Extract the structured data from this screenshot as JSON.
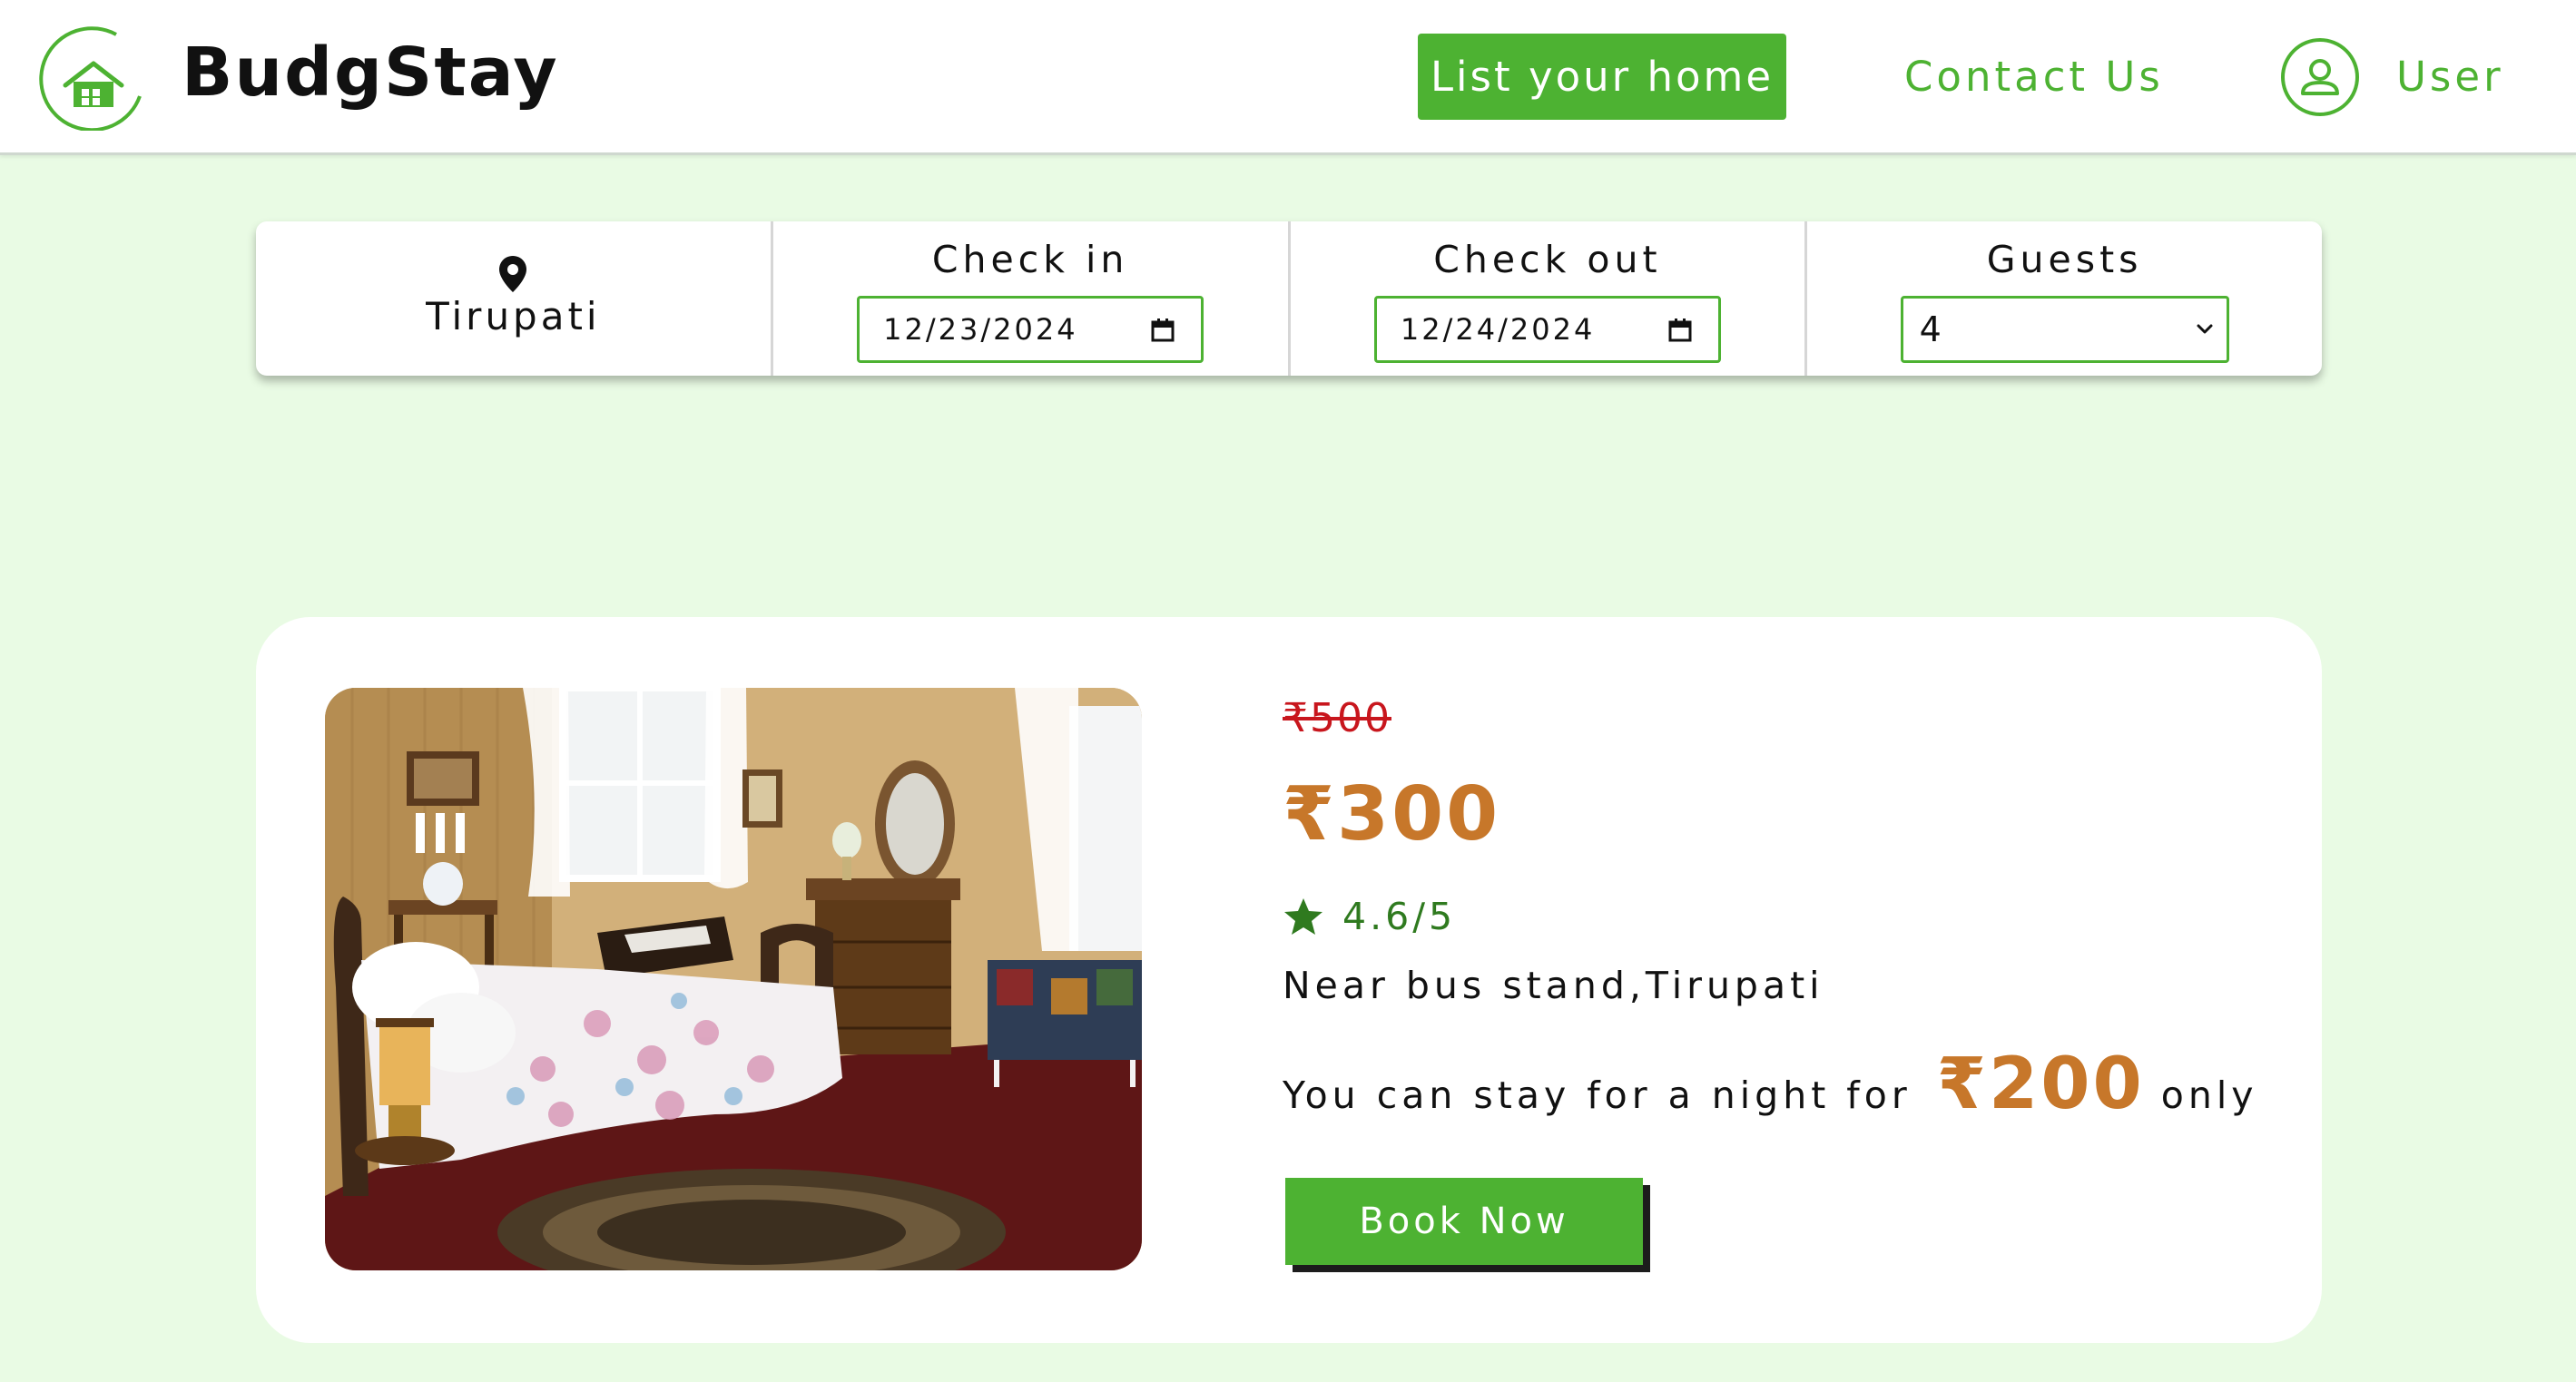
{
  "header": {
    "brand": "BudgStay",
    "list_home_label": "List your home",
    "contact_label": "Contact Us",
    "user_label": "User"
  },
  "search": {
    "location": "Tirupati",
    "check_in_label": "Check in",
    "check_in_value": "12/23/2024",
    "check_out_label": "Check out",
    "check_out_value": "12/24/2024",
    "guests_label": "Guests",
    "guests_value": "4"
  },
  "listing": {
    "original_price": "₹500",
    "current_price": "₹300",
    "rating": "4.6/5",
    "location": "Near bus stand,Tirupati",
    "promo_prefix": "You can stay for a night for",
    "promo_price": "₹200",
    "promo_suffix": "only",
    "book_label": "Book Now"
  },
  "colors": {
    "page_background": "#e9fbe4",
    "accent_green": "#4db232",
    "price_orange": "#c7772a",
    "strike_red": "#c8161d",
    "rating_green": "#2f7a1f"
  },
  "icons": [
    "house-logo-icon",
    "user-icon",
    "location-pin-icon",
    "calendar-icon",
    "chevron-down-icon",
    "star-icon"
  ]
}
